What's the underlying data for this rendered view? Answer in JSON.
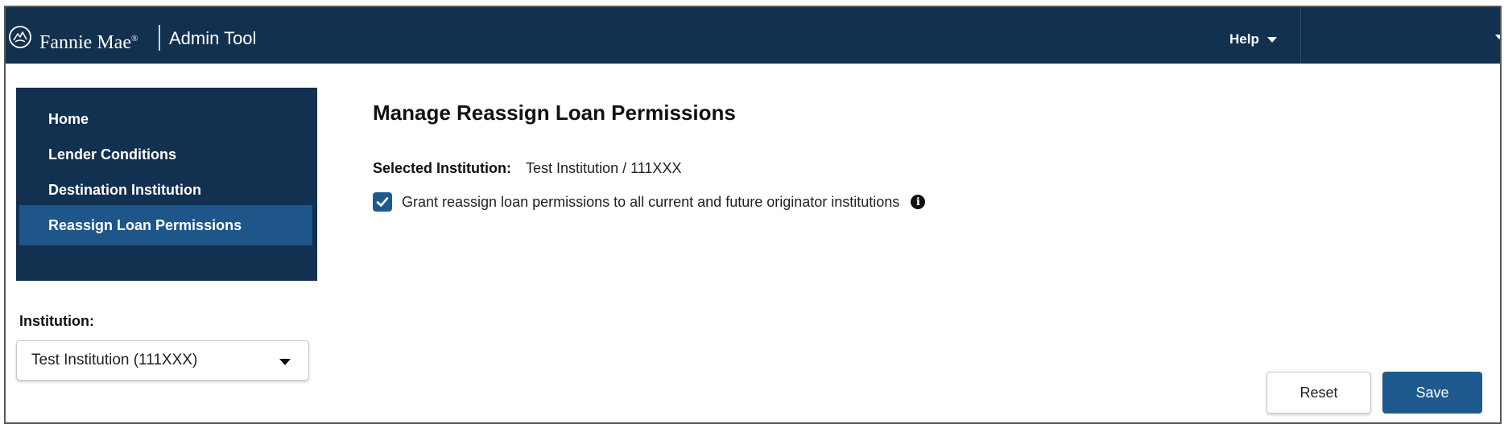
{
  "header": {
    "brand": "Fannie Mae",
    "brand_mark": "®",
    "app_name": "Admin Tool",
    "help_label": "Help",
    "logo_icon": "fannie-mae-logo-icon"
  },
  "sidebar": {
    "items": [
      {
        "label": "Home",
        "active": false
      },
      {
        "label": "Lender Conditions",
        "active": false
      },
      {
        "label": "Destination Institution",
        "active": false
      },
      {
        "label": "Reassign Loan Permissions",
        "active": true
      }
    ]
  },
  "institution": {
    "label": "Institution:",
    "selected": "Test Institution (111XXX)"
  },
  "main": {
    "title": "Manage Reassign Loan Permissions",
    "selected_institution_label": "Selected Institution:",
    "selected_institution_value": "Test Institution / 111XXX",
    "grant_checkbox_checked": true,
    "grant_label": "Grant reassign loan permissions to all current and future originator institutions"
  },
  "actions": {
    "reset_label": "Reset",
    "save_label": "Save"
  },
  "colors": {
    "header_bg": "#12304f",
    "nav_active": "#1f5689",
    "primary_button": "#1f5a8e"
  }
}
